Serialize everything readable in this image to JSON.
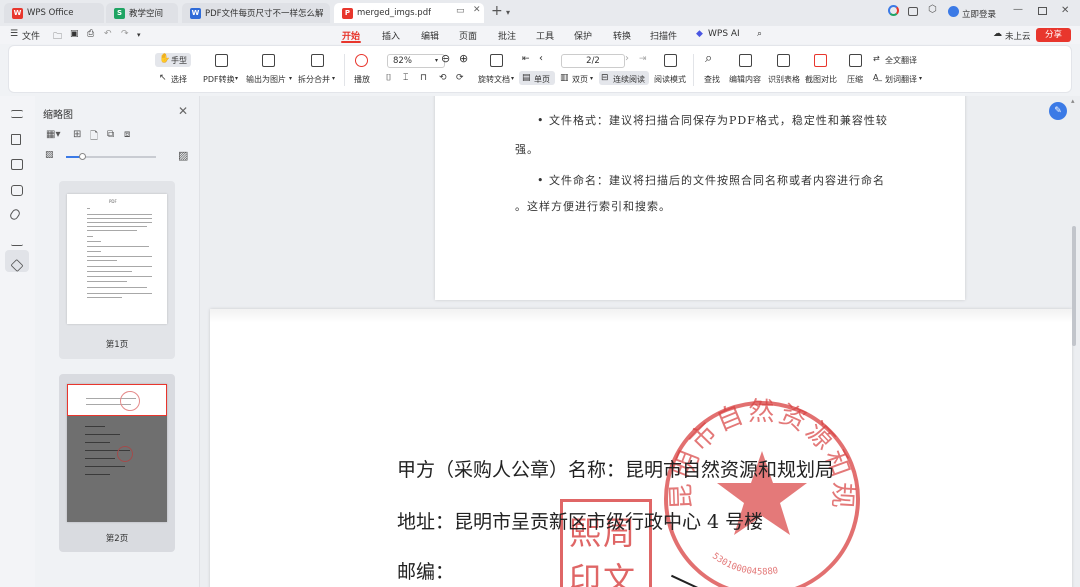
{
  "tabs": [
    {
      "label": "WPS Office",
      "icon": "wps-logo-icon",
      "color": "#e8362d"
    },
    {
      "label": "教学空间",
      "icon": "sheet-icon",
      "color": "#1fa463"
    },
    {
      "label": "PDF文件每页尺寸不一样怎么解决.d",
      "icon": "word-icon",
      "color": "#2f6bd8"
    },
    {
      "label": "merged_imgs.pdf",
      "icon": "pdf-icon",
      "color": "#e8362d"
    }
  ],
  "user": {
    "login_label": "立即登录"
  },
  "menu": {
    "file_label": "文件",
    "items": [
      "开始",
      "插入",
      "编辑",
      "页面",
      "批注",
      "工具",
      "保护",
      "转换",
      "扫描件"
    ],
    "wps_ai": "WPS AI",
    "cloud_label": "未上云",
    "share_label": "分享"
  },
  "ribbon": {
    "hand": "手型",
    "select": "选择",
    "pdf_convert": "PDF转换",
    "export_image": "输出为图片",
    "split_merge": "拆分合并",
    "play": "播放",
    "zoom": "82%",
    "rotate": "旋转文档",
    "page_indicator": "2/2",
    "single_page": "单页",
    "double_page": "双页",
    "continuous": "连续阅读",
    "read_mode": "阅读模式",
    "find": "查找",
    "edit_content": "编辑内容",
    "recognize_table": "识别表格",
    "screenshot_compare": "截图对比",
    "compress": "压缩",
    "full_translate": "全文翻译",
    "word_translate": "划词翻译"
  },
  "thumbnails": {
    "title": "缩略图",
    "pages": [
      {
        "label": "第1页",
        "title": "PDF"
      },
      {
        "label": "第2页"
      }
    ]
  },
  "document": {
    "page1_lines": [
      "• 文件格式：建议将扫描合同保存为PDF格式，稳定性和兼容性较",
      "强。",
      "• 文件命名：建议将扫描后的文件按照合同名称或者内容进行命名",
      "。这样方便进行索引和搜索。"
    ],
    "page2_lines": [
      "甲方（采购人公章）名称：昆明市自然资源和规划局",
      "地址：昆明市呈贡新区市级行政中心 4 号楼",
      "邮编："
    ],
    "seal_text": "昆明市自然资源和规划局",
    "seal_number": "5301000045880",
    "stamp_text": [
      "熙周",
      "印文"
    ]
  },
  "colors": {
    "accent": "#e8362d",
    "seal": "#d84040",
    "blue": "#3b7ae6"
  }
}
